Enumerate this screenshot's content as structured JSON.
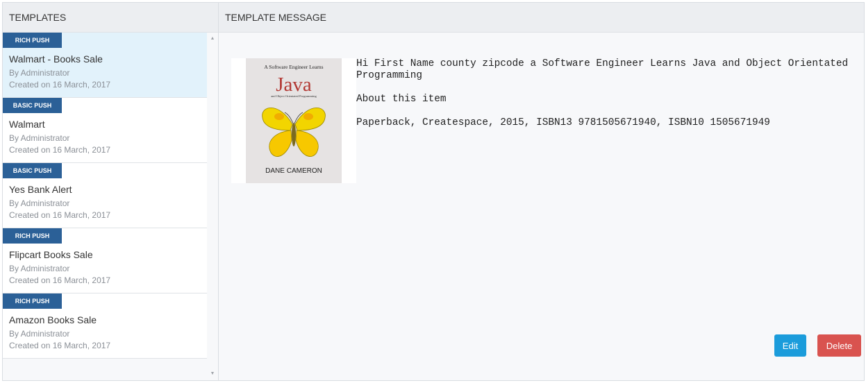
{
  "left_pane": {
    "header": "TEMPLATES",
    "items": [
      {
        "badge": "RICH PUSH",
        "title": "Walmart - Books Sale",
        "author": "By Administrator",
        "date": "Created on 16 March, 2017",
        "selected": true
      },
      {
        "badge": "BASIC PUSH",
        "title": "Walmart",
        "author": "By Administrator",
        "date": "Created on 16 March, 2017",
        "selected": false
      },
      {
        "badge": "BASIC PUSH",
        "title": "Yes Bank Alert",
        "author": "By Administrator",
        "date": "Created on 16 March, 2017",
        "selected": false
      },
      {
        "badge": "RICH PUSH",
        "title": "Flipcart Books Sale",
        "author": "By Administrator",
        "date": "Created on 16 March, 2017",
        "selected": false
      },
      {
        "badge": "RICH PUSH",
        "title": "Amazon Books Sale",
        "author": "By Administrator",
        "date": "Created on 16 March, 2017",
        "selected": false
      }
    ],
    "scroll_up_icon": "scroll-up-arrow-icon",
    "scroll_down_icon": "scroll-down-arrow-icon"
  },
  "right_pane": {
    "header": "TEMPLATE MESSAGE",
    "book_cover": {
      "top_text": "A Software Engineer Learns",
      "title": "Java",
      "subtitle": "and Object Orientated Programming",
      "author": "DANE CAMERON"
    },
    "message_lines": [
      "Hi First Name  county  zipcode a Software Engineer Learns Java and Object Orientated Programming",
      "About this item",
      "Paperback, Createspace, 2015, ISBN13 9781505671940, ISBN10 1505671949"
    ],
    "edit_label": "Edit",
    "delete_label": "Delete"
  },
  "colors": {
    "badge": "#2b6097",
    "selected_row": "#e2f2fb",
    "edit_button": "#1b9cdb",
    "delete_button": "#d9534f",
    "header_bg": "#eceef1"
  }
}
